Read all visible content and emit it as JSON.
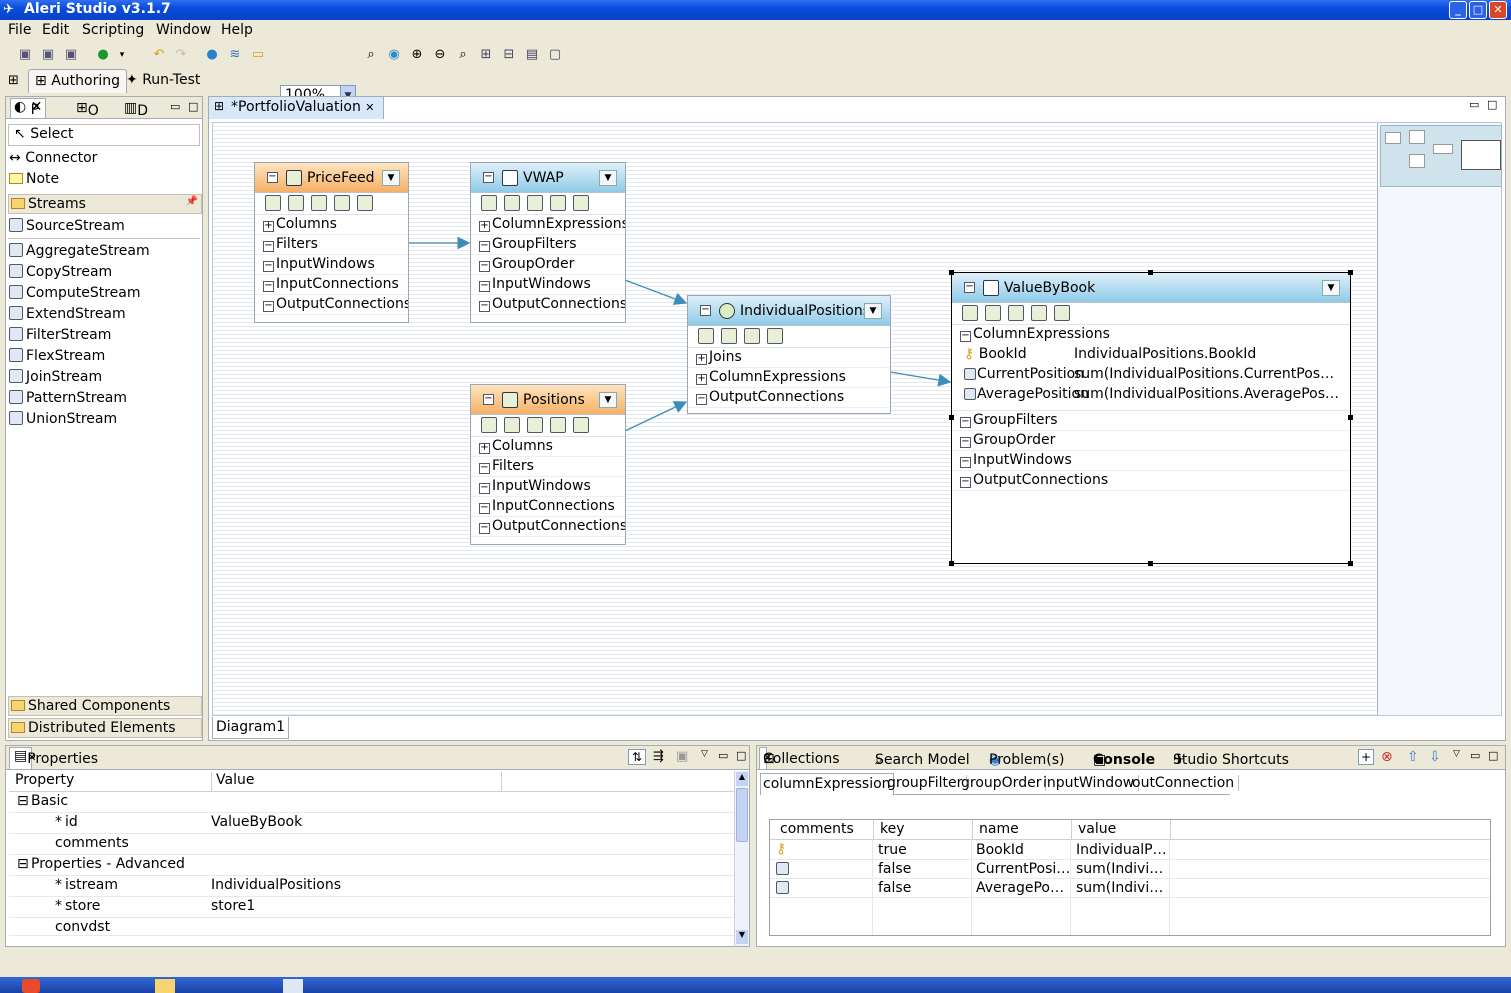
{
  "window": {
    "title": "Aleri Studio v3.1.7"
  },
  "menu": [
    "File",
    "Edit",
    "Scripting",
    "Window",
    "Help"
  ],
  "toolbar": {
    "zoom": "100%"
  },
  "perspectives": [
    {
      "label": "Authoring",
      "active": true
    },
    {
      "label": "Run-Test",
      "active": false
    }
  ],
  "left_panel": {
    "tabs": [
      "P",
      "O",
      "D"
    ],
    "tools": [
      "Select",
      "Connector",
      "Note"
    ],
    "streams_group": "Streams",
    "streams": [
      "SourceStream",
      "AggregateStream",
      "CopyStream",
      "ComputeStream",
      "ExtendStream",
      "FilterStream",
      "FlexStream",
      "JoinStream",
      "PatternStream",
      "UnionStream"
    ],
    "bottom_groups": [
      "Shared Components",
      "Distributed Elements"
    ]
  },
  "editor": {
    "tab": "*PortfolioValuation",
    "diagram_tab": "Diagram1",
    "nodes": {
      "pricefeed": {
        "title": "PriceFeed",
        "rows": [
          {
            "sign": "+",
            "label": "Columns"
          },
          {
            "sign": "−",
            "label": "Filters"
          },
          {
            "sign": "−",
            "label": "InputWindows"
          },
          {
            "sign": "−",
            "label": "InputConnections"
          },
          {
            "sign": "−",
            "label": "OutputConnections"
          }
        ]
      },
      "vwap": {
        "title": "VWAP",
        "rows": [
          {
            "sign": "+",
            "label": "ColumnExpressions"
          },
          {
            "sign": "−",
            "label": "GroupFilters"
          },
          {
            "sign": "−",
            "label": "GroupOrder"
          },
          {
            "sign": "−",
            "label": "InputWindows"
          },
          {
            "sign": "−",
            "label": "OutputConnections"
          }
        ]
      },
      "positions": {
        "title": "Positions",
        "rows": [
          {
            "sign": "+",
            "label": "Columns"
          },
          {
            "sign": "−",
            "label": "Filters"
          },
          {
            "sign": "−",
            "label": "InputWindows"
          },
          {
            "sign": "−",
            "label": "InputConnections"
          },
          {
            "sign": "−",
            "label": "OutputConnections"
          }
        ]
      },
      "individual": {
        "title": "IndividualPositions",
        "rows": [
          {
            "sign": "+",
            "label": "Joins"
          },
          {
            "sign": "+",
            "label": "ColumnExpressions"
          },
          {
            "sign": "−",
            "label": "OutputConnections"
          }
        ]
      },
      "valuebybook": {
        "title": "ValueByBook",
        "expr_header": "ColumnExpressions",
        "exprs": [
          {
            "name": "BookId",
            "value": "IndividualPositions.BookId"
          },
          {
            "name": "CurrentPosition",
            "value": "sum(IndividualPositions.CurrentPos…"
          },
          {
            "name": "AveragePosition",
            "value": "sum(IndividualPositions.AveragePos…"
          }
        ],
        "rows": [
          {
            "sign": "−",
            "label": "GroupFilters"
          },
          {
            "sign": "−",
            "label": "GroupOrder"
          },
          {
            "sign": "−",
            "label": "InputWindows"
          },
          {
            "sign": "−",
            "label": "OutputConnections"
          }
        ]
      }
    }
  },
  "properties": {
    "tab": "Properties",
    "headers": [
      "Property",
      "Value"
    ],
    "rows": [
      {
        "indent": 0,
        "sign": "⊟",
        "label": "Basic",
        "value": ""
      },
      {
        "indent": 2,
        "sign": "*",
        "label": "id",
        "value": "ValueByBook"
      },
      {
        "indent": 2,
        "sign": "",
        "label": "comments",
        "value": ""
      },
      {
        "indent": 0,
        "sign": "⊟",
        "label": "Properties - Advanced",
        "value": ""
      },
      {
        "indent": 2,
        "sign": "*",
        "label": "istream",
        "value": "IndividualPositions"
      },
      {
        "indent": 2,
        "sign": "*",
        "label": "store",
        "value": "store1"
      },
      {
        "indent": 2,
        "sign": "",
        "label": "convdst",
        "value": ""
      }
    ]
  },
  "collections": {
    "tabs": [
      "Collections",
      "Search Model",
      "Problem(s)",
      "Console",
      "Studio Shortcuts"
    ],
    "subtabs": [
      "columnExpression",
      "groupFilter",
      "groupOrder",
      "inputWindow",
      "outConnection"
    ],
    "headers": [
      "comments",
      "key",
      "name",
      "value"
    ],
    "rows": [
      {
        "icon": "key-icon",
        "key": "true",
        "name": "BookId",
        "value": "IndividualP…"
      },
      {
        "icon": "function-icon",
        "key": "false",
        "name": "CurrentPosi…",
        "value": "sum(Indivi…"
      },
      {
        "icon": "function-icon",
        "key": "false",
        "name": "AveragePo…",
        "value": "sum(Indivi…"
      }
    ]
  },
  "colors": {
    "orange_header": "#f5b066",
    "blue_header": "#8fcbe8",
    "connector": "#3d8db8"
  }
}
